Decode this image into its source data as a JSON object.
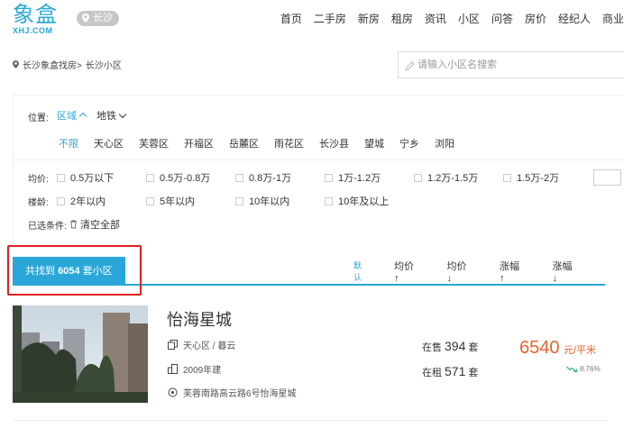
{
  "logo": {
    "cn": "象盒",
    "en": "XHJ.COM"
  },
  "city": "长沙",
  "nav": [
    "首页",
    "二手房",
    "新房",
    "租房",
    "资讯",
    "小区",
    "问答",
    "房价",
    "经纪人",
    "商业"
  ],
  "breadcrumb": {
    "home": "长沙象盒找房>",
    "current": "长沙小区"
  },
  "search": {
    "placeholder": "请输入小区名搜索"
  },
  "filter": {
    "location_label": "位置:",
    "tab_area": "区域",
    "tab_metro": "地铁",
    "districts": [
      "不限",
      "天心区",
      "芙蓉区",
      "开福区",
      "岳麓区",
      "雨花区",
      "长沙县",
      "望城",
      "宁乡",
      "浏阳"
    ],
    "price_label": "均价:",
    "price_options": [
      "0.5万以下",
      "0.5万-0.8万",
      "0.8万-1万",
      "1万-1.2万",
      "1.2万-1.5万",
      "1.5万-2万"
    ],
    "age_label": "楼龄:",
    "age_options": [
      "2年以内",
      "5年以内",
      "10年以内",
      "10年及以上"
    ],
    "selected_label": "已选条件:",
    "clear_all": "清空全部"
  },
  "results": {
    "prefix": "共找到",
    "count": "6054",
    "suffix": "套小区",
    "sorts": [
      "默认",
      "均价 ↑",
      "均价 ↓",
      "涨幅 ↑",
      "涨幅 ↓"
    ]
  },
  "listing": {
    "name": "怡海星城",
    "district": "天心区 / 暮云",
    "built": "2009年建",
    "address": "芙蓉南路高云路6号怡海星城",
    "sale_label": "在售",
    "sale_count": "394",
    "rent_label": "在租",
    "rent_count": "571",
    "unit_set": "套",
    "price": "6540",
    "price_unit": "元/平米",
    "change": "8.76%"
  },
  "colors": {
    "accent": "#2aa7d8",
    "price": "#e8632c",
    "highlight": "#e02020"
  }
}
